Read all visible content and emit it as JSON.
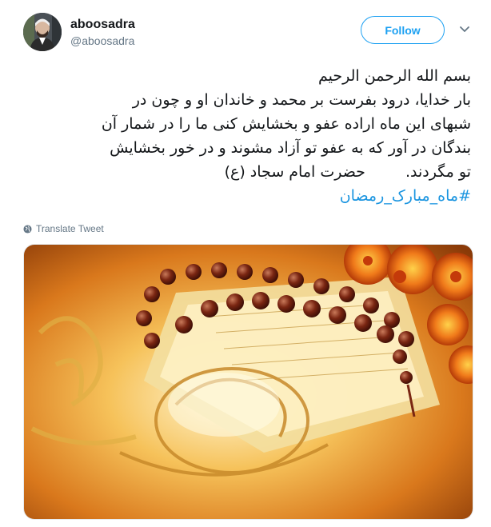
{
  "user": {
    "display_name": "aboosadra",
    "handle": "@aboosadra"
  },
  "actions": {
    "follow_label": "Follow"
  },
  "tweet": {
    "lines": [
      "بسم الله الرحمن الرحیم",
      "بار خدایا، درود بفرست بر محمد و خاندان او و چون در",
      "شبهای این ماه اراده عفو و بخشایش کنی ما را در شمار آن",
      "بندگان در آور که به عفو تو آزاد مشوند و در خور بخشایش"
    ],
    "last_line_start": "تو مگردند.",
    "last_line_attribution": "حضرت امام سجاد (ع)",
    "hashtag": "#ماه_مبارک_رمضان"
  },
  "translate_label": "Translate Tweet",
  "colors": {
    "accent": "#1da1f2",
    "hashtag": "#1b95e0",
    "muted": "#657786",
    "text": "#14171a"
  },
  "icons": {
    "avatar": "avatar",
    "caret": "chevron-down-icon",
    "translate": "globe-icon"
  }
}
